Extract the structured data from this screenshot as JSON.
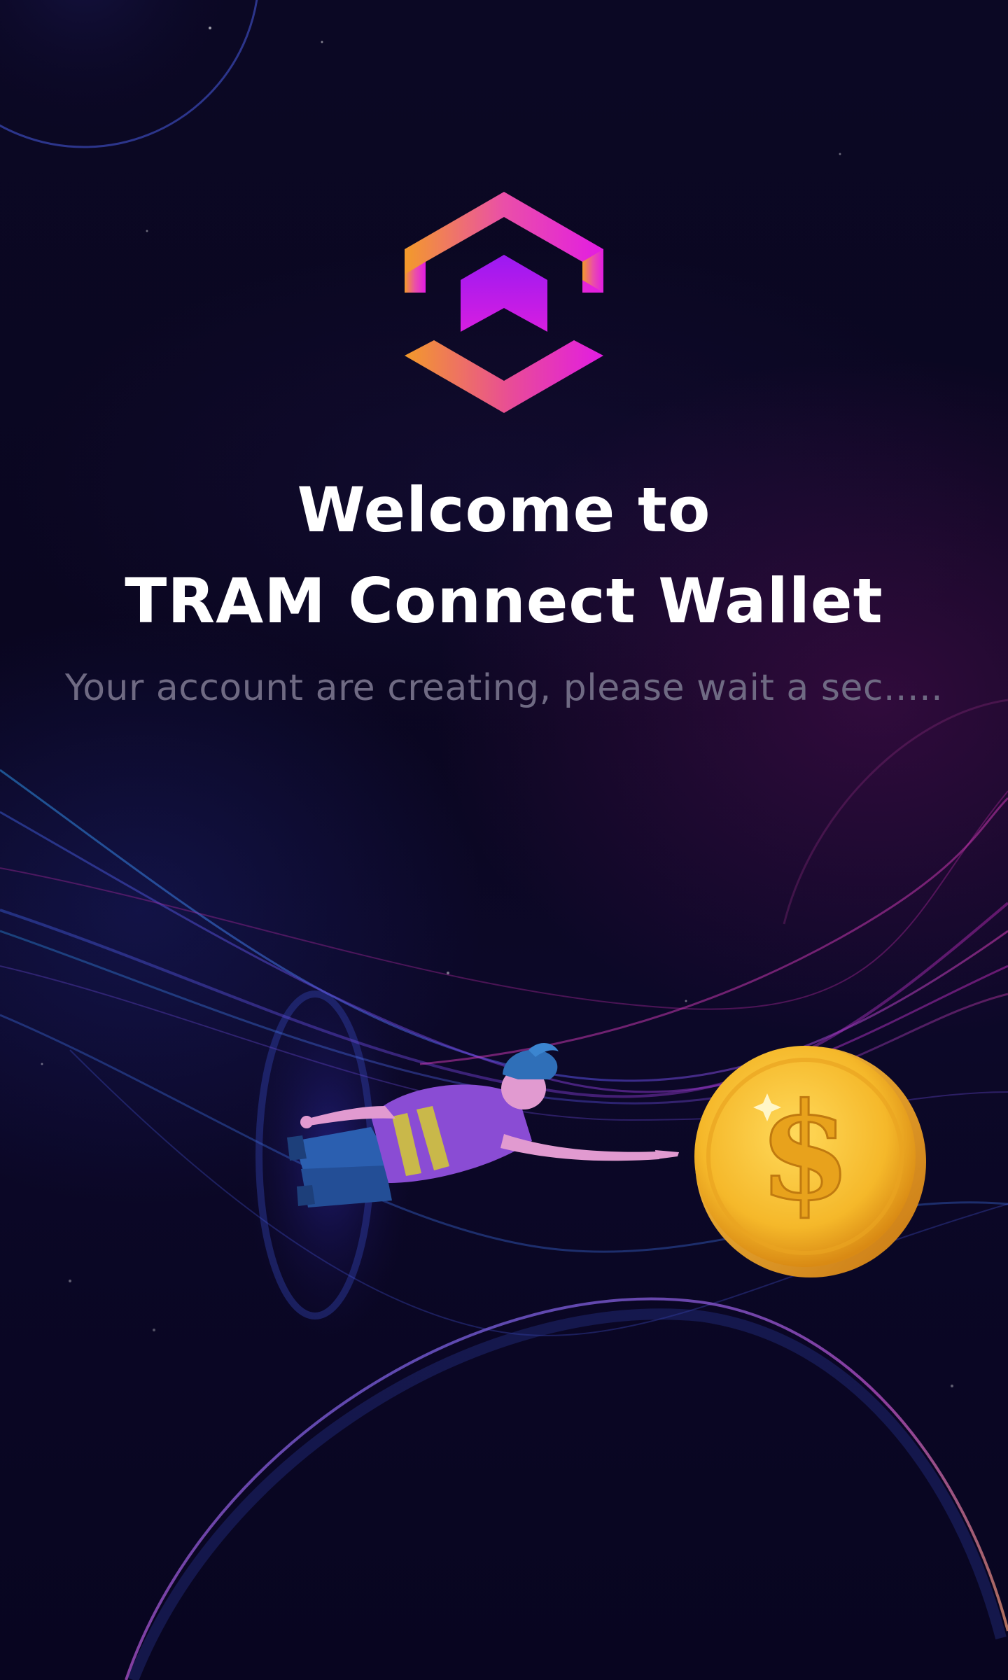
{
  "welcome": {
    "title_line1": "Welcome to",
    "title_line2": "TRAM Connect Wallet",
    "subtitle": "Your account are creating, please wait a sec....."
  },
  "icons": {
    "logo": "tram-hexagon-logo-icon",
    "coin": "dollar-coin-icon"
  },
  "colors": {
    "background": "#0a0620",
    "title": "#ffffff",
    "subtitle": "#6f6a83",
    "logo_orange": "#f39a2a",
    "logo_magenta": "#e21ce3",
    "logo_purple": "#9b19f2",
    "coin_gold": "#f5b82a"
  }
}
